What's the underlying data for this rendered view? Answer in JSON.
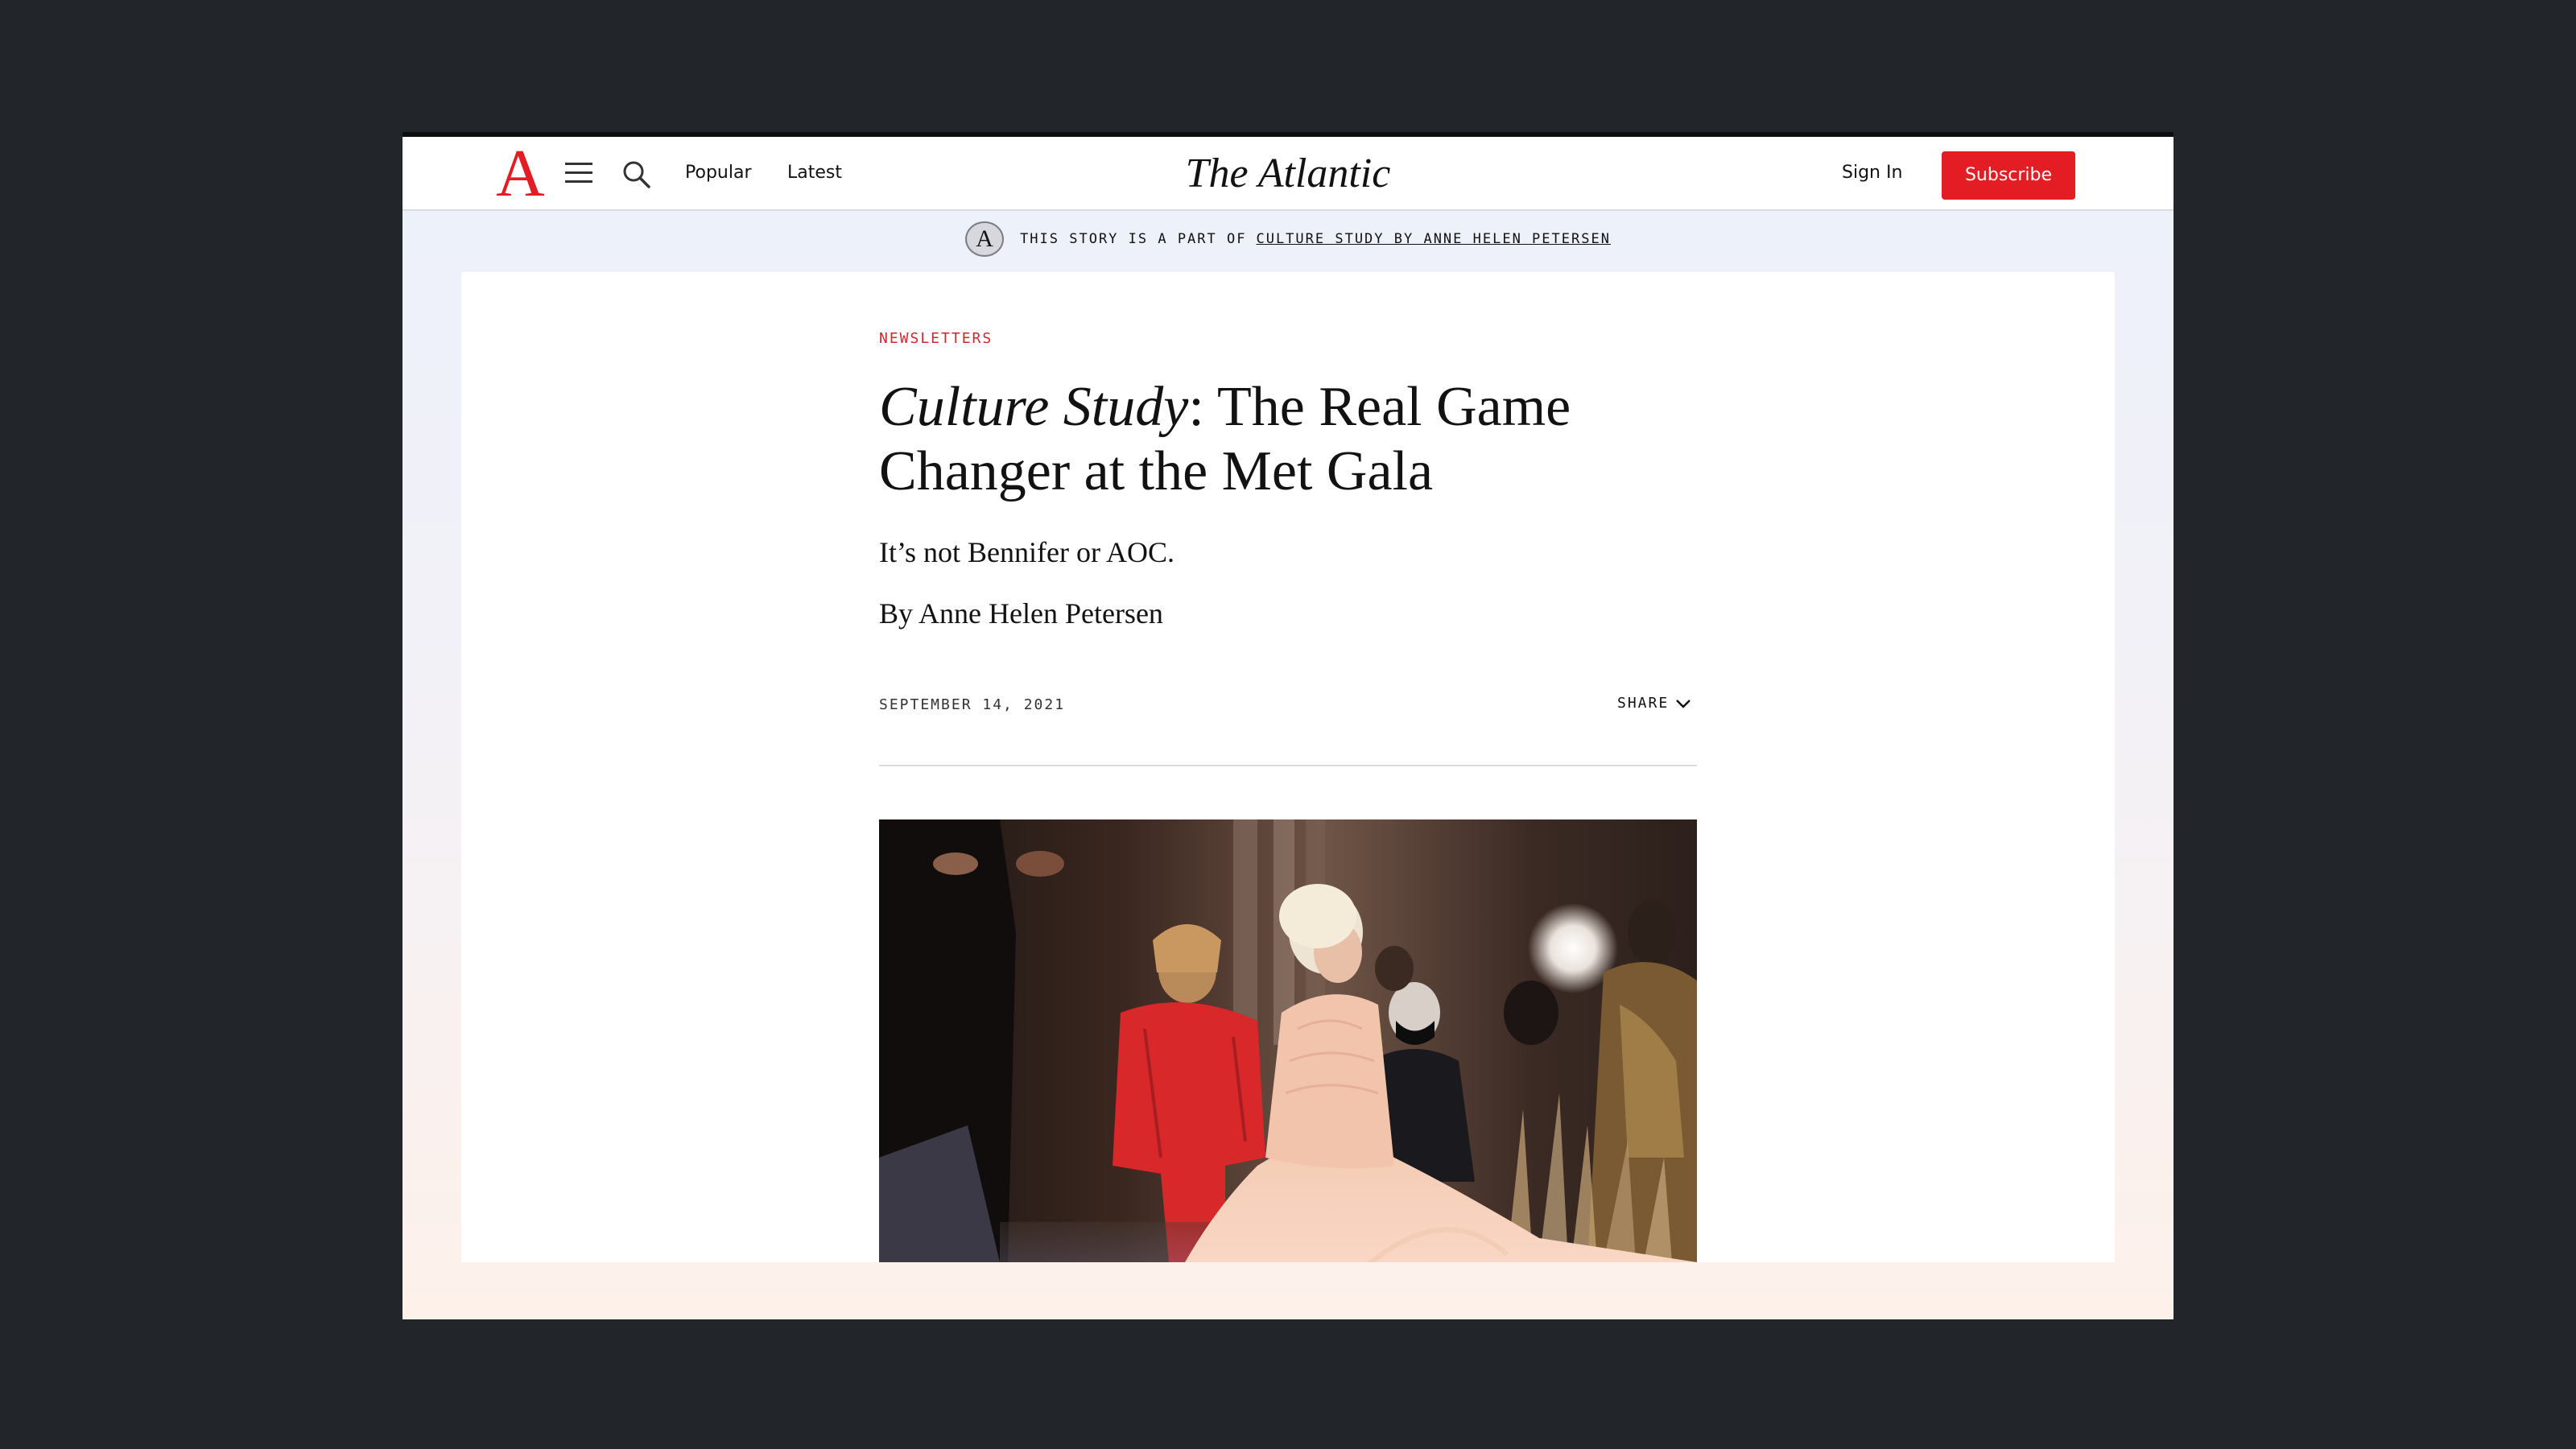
{
  "header": {
    "logo_letter": "A",
    "nav": {
      "popular": "Popular",
      "latest": "Latest"
    },
    "brand": "The Atlantic",
    "sign_in": "Sign In",
    "subscribe": "Subscribe"
  },
  "series": {
    "badge": "A",
    "prefix": "THIS STORY IS A PART OF",
    "link": "CULTURE STUDY BY ANNE HELEN PETERSEN"
  },
  "article": {
    "section": "NEWSLETTERS",
    "headline_italic": "Culture Study",
    "headline_rest": ": The Real Game Changer at the Met Gala",
    "dek": "It’s not Bennifer or AOC.",
    "byline_prefix": "By",
    "author": "Anne Helen Petersen",
    "date": "SEPTEMBER 14, 2021",
    "share": "SHARE"
  },
  "colors": {
    "accent": "#e41c24",
    "section_label": "#d0282f",
    "dress": "#f6c6ad",
    "suit": "#d8282a"
  },
  "icons": [
    "logo-a-icon",
    "menu-icon",
    "search-icon",
    "chevron-down-icon"
  ]
}
